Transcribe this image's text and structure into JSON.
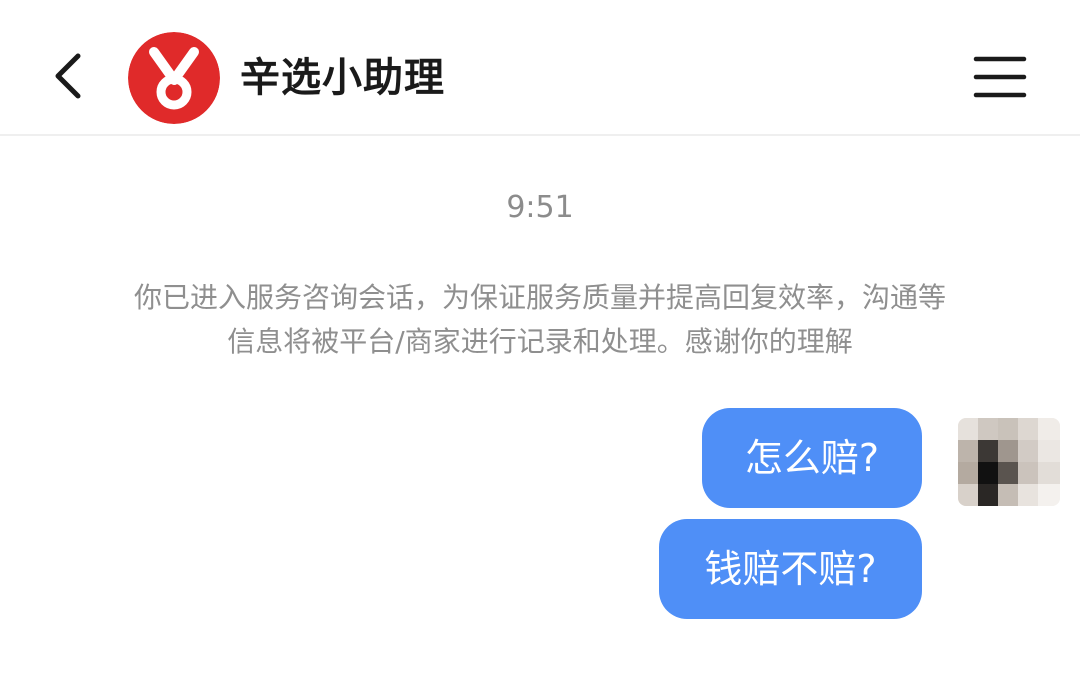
{
  "header": {
    "title": "辛选小助理",
    "back_icon": "chevron-left-icon",
    "menu_icon": "hamburger-menu-icon",
    "logo_color": "#e02a2a"
  },
  "chat": {
    "timestamp": "9:51",
    "notice_line1": "你已进入服务咨询会话，为保证服务质量并提高回复效率，沟通等",
    "notice_line2": "信息将被平台/商家进行记录和处理。感谢你的理解",
    "messages": [
      {
        "text": "怎么赔?"
      },
      {
        "text": "钱赔不赔?"
      }
    ],
    "bubble_color": "#4f8ff7"
  }
}
